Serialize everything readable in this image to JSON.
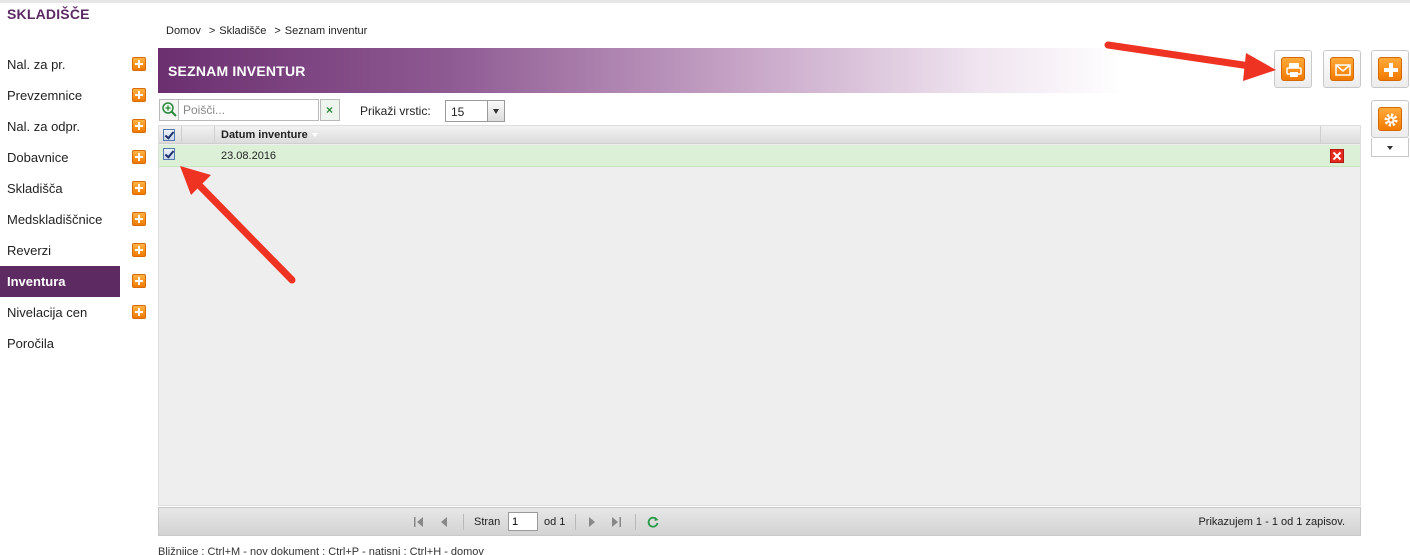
{
  "sidebar": {
    "title": "SKLADIŠČE",
    "items": [
      {
        "label": "Nal. za pr.",
        "has_add": true
      },
      {
        "label": "Prevzemnice",
        "has_add": true
      },
      {
        "label": "Nal. za odpr.",
        "has_add": true
      },
      {
        "label": "Dobavnice",
        "has_add": true
      },
      {
        "label": "Skladišča",
        "has_add": true
      },
      {
        "label": "Medskladiščnice",
        "has_add": true
      },
      {
        "label": "Reverzi",
        "has_add": true
      },
      {
        "label": "Inventura",
        "has_add": true,
        "active": true
      },
      {
        "label": "Nivelacija cen",
        "has_add": true
      },
      {
        "label": "Poročila",
        "has_add": false
      }
    ]
  },
  "breadcrumb": {
    "items": [
      "Domov",
      "Skladišče",
      "Seznam inventur"
    ],
    "separator": ">"
  },
  "header": {
    "title": "SEZNAM INVENTUR"
  },
  "actions": {
    "icons": [
      "print-icon",
      "mail-icon",
      "plus-icon",
      "gear-icon"
    ]
  },
  "toolbar": {
    "search_placeholder": "Poišči...",
    "rows_label": "Prikaži vrstic:",
    "rows_value": "15"
  },
  "grid": {
    "columns": [
      "Datum inventure"
    ],
    "rows": [
      {
        "date": "23.08.2016",
        "checked": true
      }
    ]
  },
  "pager": {
    "page_label": "Stran",
    "page_value": "1",
    "of_label": "od 1",
    "info": "Prikazujem 1 - 1 od 1 zapisov."
  },
  "footer": {
    "shortcuts": "Bližnjice : Ctrl+M - nov dokument ;   Ctrl+P - natisni ;   Ctrl+H - domov"
  },
  "colors": {
    "brand_purple": "#5e2a62",
    "accent_orange": "#f27a00",
    "row_highlight": "#dcf0d8",
    "annotation_red": "#ee3322"
  }
}
